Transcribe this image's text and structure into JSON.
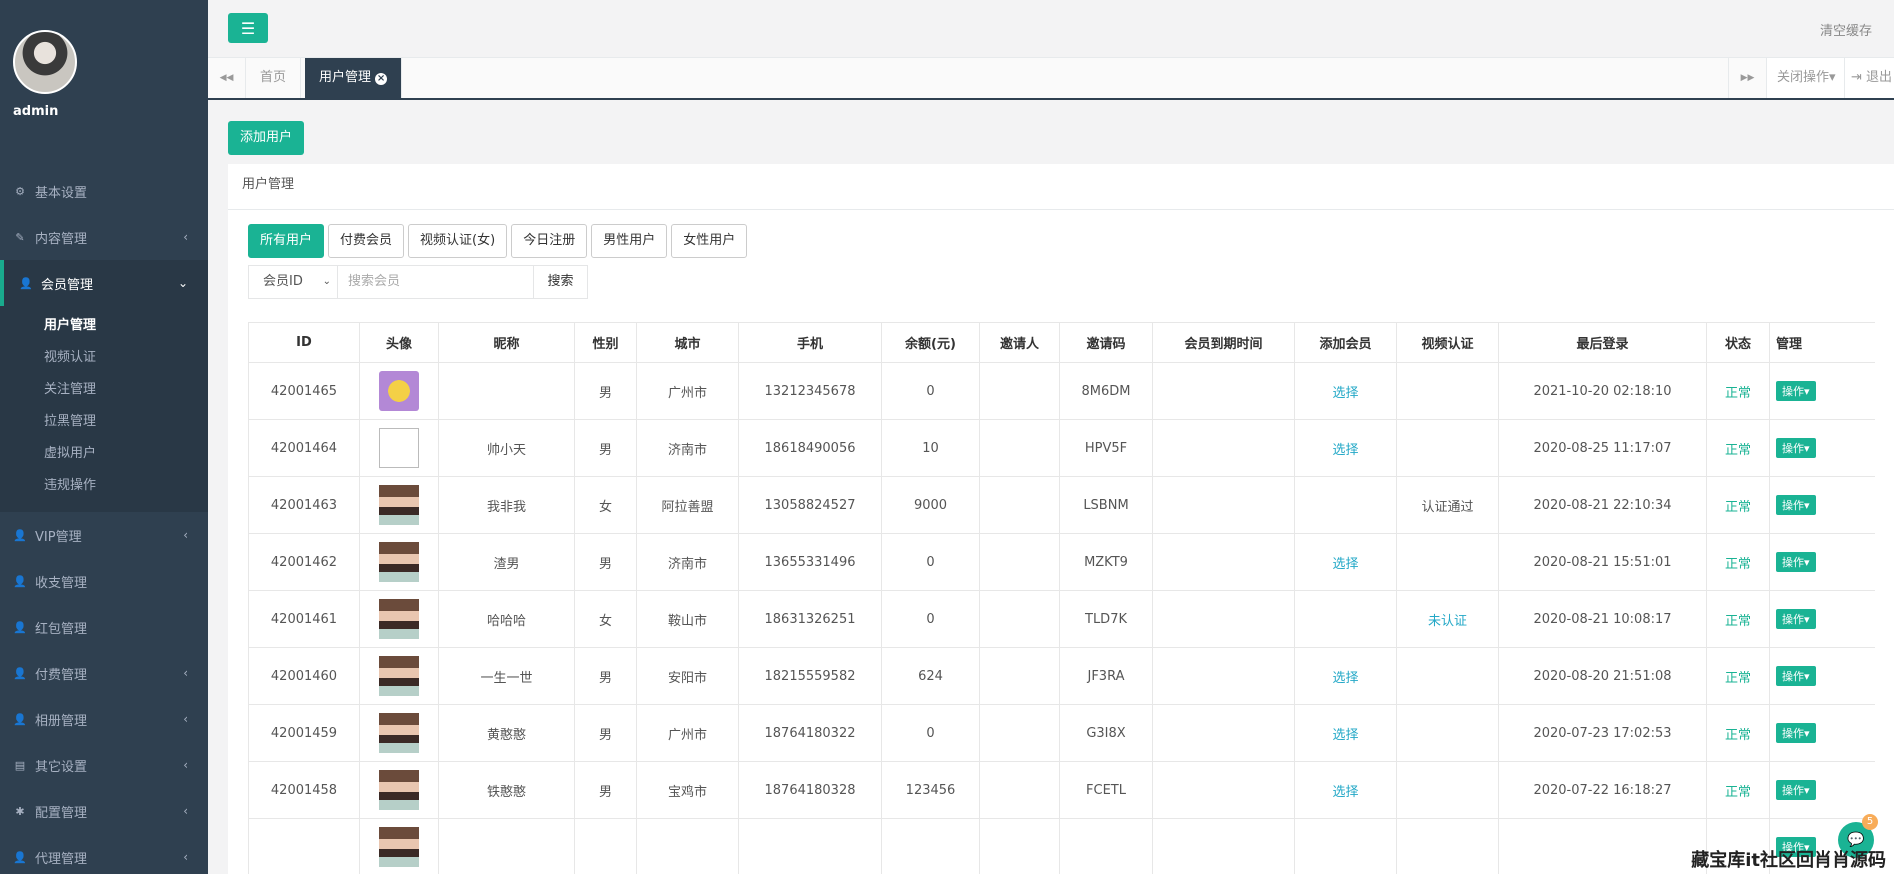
{
  "sidebar": {
    "user": "admin",
    "items": [
      {
        "label": "基本设置",
        "icon": "gear-icon",
        "glyph": "⚙",
        "arrow": ""
      },
      {
        "label": "内容管理",
        "icon": "edit-icon",
        "glyph": "✎",
        "arrow": "‹"
      },
      {
        "label": "会员管理",
        "icon": "user-icon",
        "glyph": "👤",
        "arrow": "⌄"
      },
      {
        "label": "VIP管理",
        "icon": "user-icon",
        "glyph": "👤",
        "arrow": "‹"
      },
      {
        "label": "收支管理",
        "icon": "user-icon",
        "glyph": "👤",
        "arrow": ""
      },
      {
        "label": "红包管理",
        "icon": "user-icon",
        "glyph": "👤",
        "arrow": ""
      },
      {
        "label": "付费管理",
        "icon": "user-icon",
        "glyph": "👤",
        "arrow": "‹"
      },
      {
        "label": "相册管理",
        "icon": "user-icon",
        "glyph": "👤",
        "arrow": "‹"
      },
      {
        "label": "其它设置",
        "icon": "list-icon",
        "glyph": "▤",
        "arrow": "‹"
      },
      {
        "label": "配置管理",
        "icon": "asterisk-icon",
        "glyph": "✱",
        "arrow": "‹"
      },
      {
        "label": "代理管理",
        "icon": "user-icon",
        "glyph": "👤",
        "arrow": "‹"
      }
    ],
    "submenu": [
      "用户管理",
      "视频认证",
      "关注管理",
      "拉黑管理",
      "虚拟用户",
      "违规操作"
    ]
  },
  "topbar": {
    "menu_glyph": "☰",
    "clear_cache": "清空缓存"
  },
  "tabs": {
    "back": "◀◀",
    "home": "首页",
    "active": "用户管理",
    "forward": "▶▶",
    "close_ops": "关闭操作▾",
    "logout": "⇥ 退出"
  },
  "content": {
    "add_user": "添加用户",
    "panel_title": "用户管理",
    "filters": [
      "所有用户",
      "付费会员",
      "视频认证(女)",
      "今日注册",
      "男性用户",
      "女性用户"
    ],
    "search": {
      "field": "会员ID",
      "placeholder": "搜索会员",
      "button": "搜索"
    }
  },
  "table": {
    "headers": [
      "ID",
      "头像",
      "昵称",
      "性别",
      "城市",
      "手机",
      "余额(元)",
      "邀请人",
      "邀请码",
      "会员到期时间",
      "添加会员",
      "视频认证",
      "最后登录",
      "状态",
      "管理"
    ],
    "rows": [
      {
        "id": "42001465",
        "avatar": "a1",
        "nick": "",
        "sex": "男",
        "city": "广州市",
        "phone": "13212345678",
        "balance": "0",
        "inviter": "",
        "code": "8M6DM",
        "expire": "",
        "add": "选择",
        "video": "",
        "login": "2021-10-20 02:18:10",
        "status": "正常",
        "op": "操作▾"
      },
      {
        "id": "42001464",
        "avatar": "broken",
        "nick": "帅小天",
        "sex": "男",
        "city": "济南市",
        "phone": "18618490056",
        "balance": "10",
        "inviter": "",
        "code": "HPV5F",
        "expire": "",
        "add": "选择",
        "video": "",
        "login": "2020-08-25 11:17:07",
        "status": "正常",
        "op": "操作▾"
      },
      {
        "id": "42001463",
        "avatar": "p",
        "nick": "我非我",
        "sex": "女",
        "city": "阿拉善盟",
        "phone": "13058824527",
        "balance": "9000",
        "inviter": "",
        "code": "LSBNM",
        "expire": "",
        "add": "",
        "video": "认证通过",
        "login": "2020-08-21 22:10:34",
        "status": "正常",
        "op": "操作▾"
      },
      {
        "id": "42001462",
        "avatar": "p",
        "nick": "渣男",
        "sex": "男",
        "city": "济南市",
        "phone": "13655331496",
        "balance": "0",
        "inviter": "",
        "code": "MZKT9",
        "expire": "",
        "add": "选择",
        "video": "",
        "login": "2020-08-21 15:51:01",
        "status": "正常",
        "op": "操作▾"
      },
      {
        "id": "42001461",
        "avatar": "p",
        "nick": "哈哈哈",
        "sex": "女",
        "city": "鞍山市",
        "phone": "18631326251",
        "balance": "0",
        "inviter": "",
        "code": "TLD7K",
        "expire": "",
        "add": "",
        "video": "未认证",
        "login": "2020-08-21 10:08:17",
        "status": "正常",
        "op": "操作▾"
      },
      {
        "id": "42001460",
        "avatar": "p",
        "nick": "一生一世",
        "sex": "男",
        "city": "安阳市",
        "phone": "18215559582",
        "balance": "624",
        "inviter": "",
        "code": "JF3RA",
        "expire": "",
        "add": "选择",
        "video": "",
        "login": "2020-08-20 21:51:08",
        "status": "正常",
        "op": "操作▾"
      },
      {
        "id": "42001459",
        "avatar": "p",
        "nick": "黄憨憨",
        "sex": "男",
        "city": "广州市",
        "phone": "18764180322",
        "balance": "0",
        "inviter": "",
        "code": "G3I8X",
        "expire": "",
        "add": "选择",
        "video": "",
        "login": "2020-07-23 17:02:53",
        "status": "正常",
        "op": "操作▾"
      },
      {
        "id": "42001458",
        "avatar": "p",
        "nick": "铁憨憨",
        "sex": "男",
        "city": "宝鸡市",
        "phone": "18764180328",
        "balance": "123456",
        "inviter": "",
        "code": "FCETL",
        "expire": "",
        "add": "选择",
        "video": "",
        "login": "2020-07-22 16:18:27",
        "status": "正常",
        "op": "操作▾"
      },
      {
        "id": "",
        "avatar": "p",
        "nick": "",
        "sex": "",
        "city": "",
        "phone": "",
        "balance": "",
        "inviter": "",
        "code": "",
        "expire": "",
        "add": "",
        "video": "",
        "login": "",
        "status": "",
        "op": "操作▾"
      }
    ]
  },
  "widgets": {
    "chat_glyph": "💬",
    "chat_badge": "5",
    "footer_mark": "藏宝库it社区回肖肖源码"
  }
}
